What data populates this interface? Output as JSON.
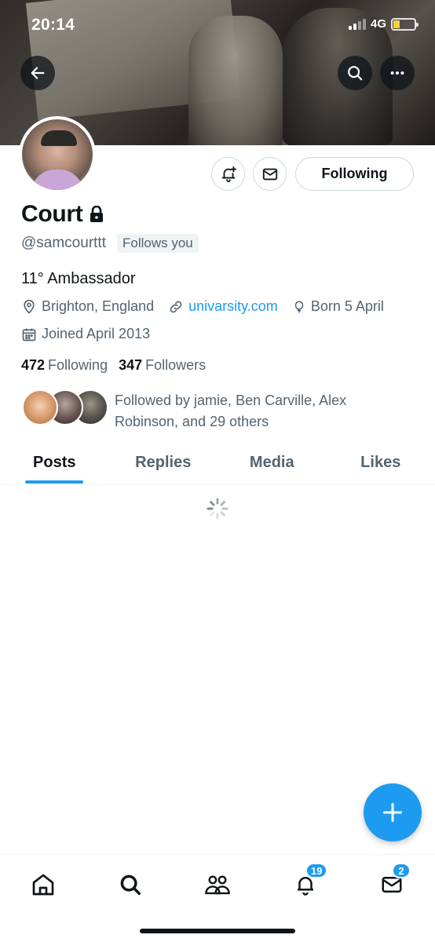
{
  "status_bar": {
    "time": "20:14",
    "network": "4G",
    "battery_level": 0.3
  },
  "header": {
    "back_icon": "arrow-left-icon",
    "search_icon": "search-icon",
    "more_icon": "more-horizontal-icon"
  },
  "profile": {
    "name": "Court",
    "handle": "@samcourttt",
    "follows_you": "Follows you",
    "bio": "11° Ambassador",
    "location": "Brighton, England",
    "website": "univarsity.com",
    "birthday": "Born 5 April",
    "joined": "Joined April 2013",
    "following_count": "472",
    "following_label": "Following",
    "followers_count": "347",
    "followers_label": "Followers",
    "followed_by": "Followed by jamie, Ben Carville, Alex Robinson, and 29 others"
  },
  "actions": {
    "follow_button": "Following"
  },
  "tabs": [
    {
      "label": "Posts",
      "active": true
    },
    {
      "label": "Replies",
      "active": false
    },
    {
      "label": "Media",
      "active": false
    },
    {
      "label": "Likes",
      "active": false
    }
  ],
  "bottom_nav": {
    "notifications_badge": "19",
    "messages_badge": "2"
  },
  "colors": {
    "accent": "#1d9bf0",
    "text_primary": "#0f1419",
    "text_secondary": "#536471"
  }
}
